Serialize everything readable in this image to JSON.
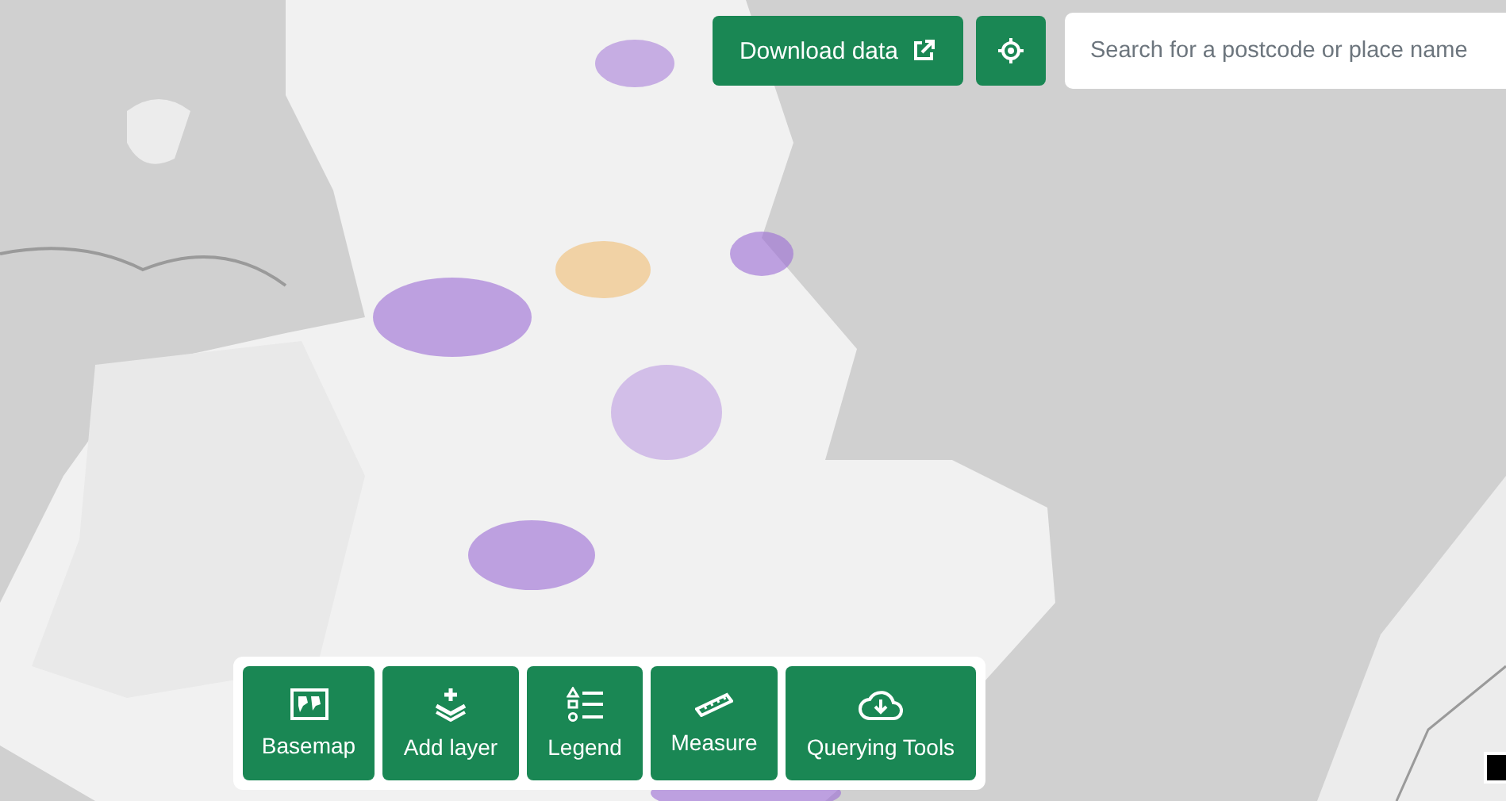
{
  "download_button": {
    "label": "Download data"
  },
  "search": {
    "placeholder": "Search for a postcode or place name"
  },
  "toolbar": [
    {
      "label": "Basemap",
      "kind": "basemap"
    },
    {
      "label": "Add layer",
      "kind": "add-layer"
    },
    {
      "label": "Legend",
      "kind": "legend"
    },
    {
      "label": "Measure",
      "kind": "measure"
    },
    {
      "label": "Querying Tools",
      "kind": "query"
    }
  ]
}
